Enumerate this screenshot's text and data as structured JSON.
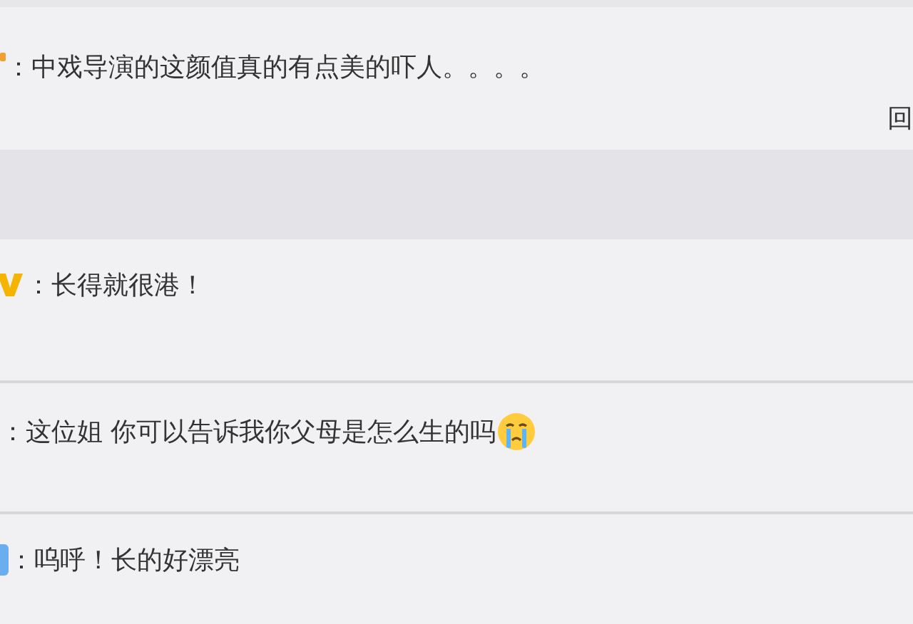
{
  "post": {
    "kind": "orange",
    "text": "：中戏导演的这颜值真的有点美的吓人。。。。",
    "reply": "回"
  },
  "comments": [
    {
      "kind": "vip",
      "text": "：长得就很港！",
      "emoji": false
    },
    {
      "kind": "plain",
      "text": "：这位姐 你可以告诉我你父母是怎么生的吗",
      "emoji": true
    },
    {
      "kind": "blue",
      "text": "：呜呼！长的好漂亮",
      "emoji": false
    }
  ]
}
